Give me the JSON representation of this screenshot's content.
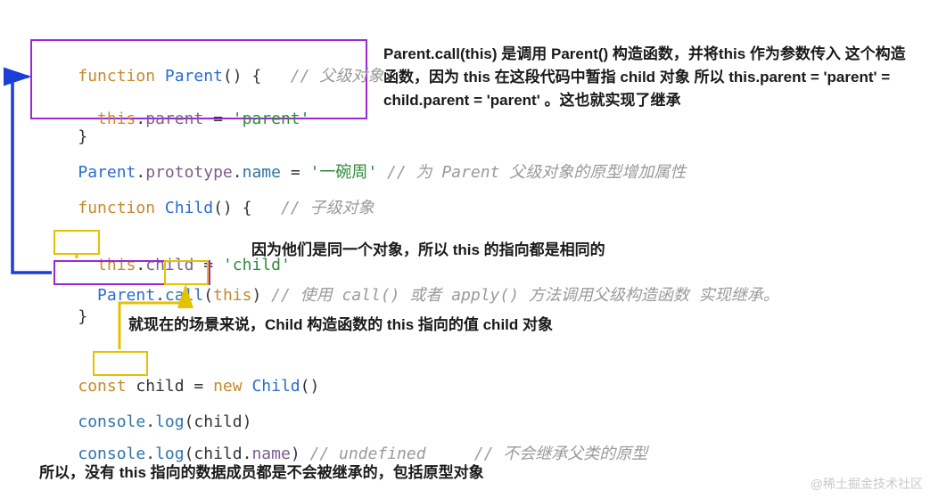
{
  "code": {
    "l1_kw": "function",
    "l1_fn": " Parent",
    "l1_paren": "() {",
    "l1_cm": "   // 父级对象",
    "l3_this": "  this",
    "l3_dot": ".",
    "l3_prop": "parent",
    "l3_eq": " = ",
    "l3_str": "'parent'",
    "l4_close": "}",
    "l6_a": "Parent",
    "l6_b": ".",
    "l6_c": "prototype",
    "l6_d": ".",
    "l6_e": "name",
    "l6_eq": " = ",
    "l6_str": "'一碗周'",
    "l6_cm": " // 为 Parent 父级对象的原型增加属性",
    "l8_kw": "function",
    "l8_fn": " Child",
    "l8_paren": "() {",
    "l8_cm": "   // 子级对象",
    "l10_this": "  this",
    "l10_dot": ".",
    "l10_prop": "child",
    "l10_eq": " = ",
    "l10_str": "'child'",
    "l11_a": "  Parent",
    "l11_b": ".",
    "l11_c": "call",
    "l11_d": "(",
    "l11_e": "this",
    "l11_f": ")",
    "l11_cm": " // 使用 call() 或者 apply() 方法调用父级构造函数 实现继承。",
    "l12_close": "}",
    "l14_kw": "const",
    "l14_var": " child",
    "l14_eq": " = ",
    "l14_new": "new",
    "l14_fn": " Child",
    "l14_paren": "()",
    "l16_a": "console",
    "l16_b": ".",
    "l16_c": "log",
    "l16_d": "(child)",
    "l18_a": "console",
    "l18_b": ".",
    "l18_c": "log",
    "l18_d": "(child",
    "l18_e": ".",
    "l18_f": "name",
    "l18_g": ")",
    "l18_cm1": " // undefined",
    "l18_cm2": "     // 不会继承父类的原型"
  },
  "anno": {
    "top_block": "Parent.call(this) 是调用 Parent() 构造函数，并将this 作为参数传入 这个构造函数，因为 this 在这段代码中暂指 child 对象 所以 this.parent = 'parent' = child.parent = 'parent' 。这也就实现了继承",
    "mid_right": "因为他们是同一个对象，所以 this 的指向都是相同的",
    "mid_below": "就现在的场景来说，Child 构造函数的 this 指向的值 child 对象",
    "bottom": "所以，没有 this 指向的数据成员都是不会被继承的，包括原型对象"
  },
  "watermark": "@稀土掘金技术社区"
}
